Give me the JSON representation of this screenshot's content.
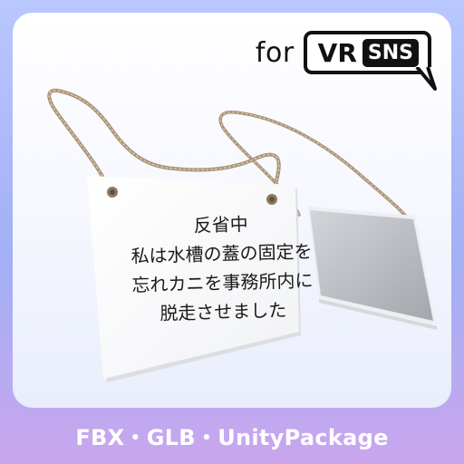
{
  "badge": {
    "for_label": "for",
    "vr_label": "VR",
    "sns_label": "SNS"
  },
  "sign": {
    "lines": [
      "反省中",
      "私は水槽の蓋の固定を",
      "忘れカニを事務所内に",
      "脱走させました"
    ]
  },
  "footer": {
    "formats": "FBX・GLB・UnityPackage"
  },
  "colors": {
    "background_top": "#b9c7ff",
    "background_bottom": "#c9a6ee",
    "rope": "#b09a7c"
  }
}
